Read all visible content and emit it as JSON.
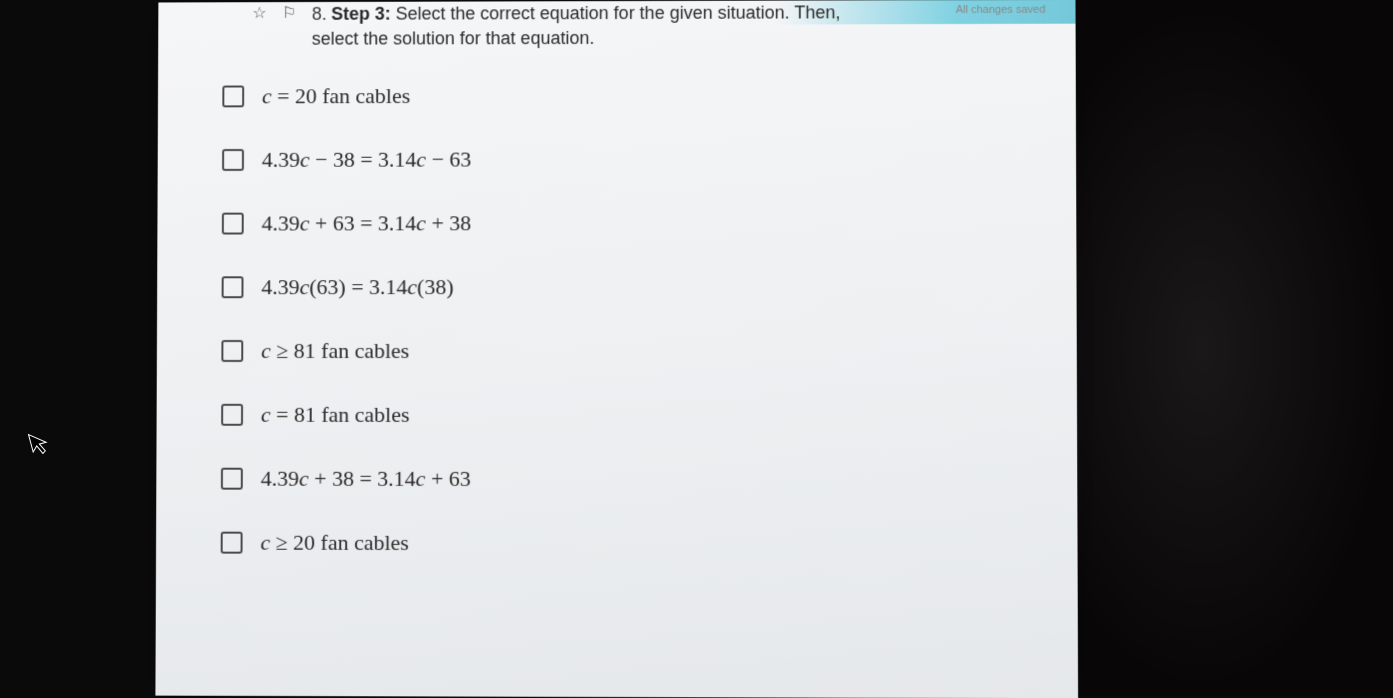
{
  "header": {
    "save_status": "All changes saved",
    "question_number": "8.",
    "question_title": "Step 3:",
    "question_body_line1": " Select the correct equation for the given situation. Then,",
    "question_body_line2": "select the solution for that equation."
  },
  "options": [
    {
      "text_var": "c",
      "text_rest": " = 20  fan cables"
    },
    {
      "text_var": "",
      "text_rest": "4.39c − 38 = 3.14c − 63",
      "is_equation": true,
      "equation": {
        "lhs_coef": "4.39",
        "lhs_var": "c",
        "lhs_op": " − ",
        "lhs_const": "38",
        "eq": " = ",
        "rhs_coef": "3.14",
        "rhs_var": "c",
        "rhs_op": " − ",
        "rhs_const": "63"
      }
    },
    {
      "text_var": "",
      "text_rest": "4.39c + 63 = 3.14c + 38",
      "is_equation": true,
      "equation": {
        "lhs_coef": "4.39",
        "lhs_var": "c",
        "lhs_op": " + ",
        "lhs_const": "63",
        "eq": " = ",
        "rhs_coef": "3.14",
        "rhs_var": "c",
        "rhs_op": " + ",
        "rhs_const": "38"
      }
    },
    {
      "text_var": "",
      "text_rest": "4.39c(63) = 3.14c(38)",
      "is_equation": true,
      "equation": {
        "lhs_coef": "4.39",
        "lhs_var": "c",
        "lhs_op": "(",
        "lhs_const": "63)",
        "eq": " = ",
        "rhs_coef": "3.14",
        "rhs_var": "c",
        "rhs_op": "(",
        "rhs_const": "38)"
      }
    },
    {
      "text_var": "c",
      "text_rest": " ≥ 81  fan cables"
    },
    {
      "text_var": "c",
      "text_rest": " = 81  fan cables"
    },
    {
      "text_var": "",
      "text_rest": "4.39c + 38 = 3.14c + 63",
      "is_equation": true,
      "equation": {
        "lhs_coef": "4.39",
        "lhs_var": "c",
        "lhs_op": " + ",
        "lhs_const": "38",
        "eq": " = ",
        "rhs_coef": "3.14",
        "rhs_var": "c",
        "rhs_op": " + ",
        "rhs_const": "63"
      }
    },
    {
      "text_var": "c",
      "text_rest": " ≥ 20  fan cables"
    }
  ],
  "icons": {
    "star": "☆",
    "flag": "⚐",
    "cursor": "➤"
  }
}
